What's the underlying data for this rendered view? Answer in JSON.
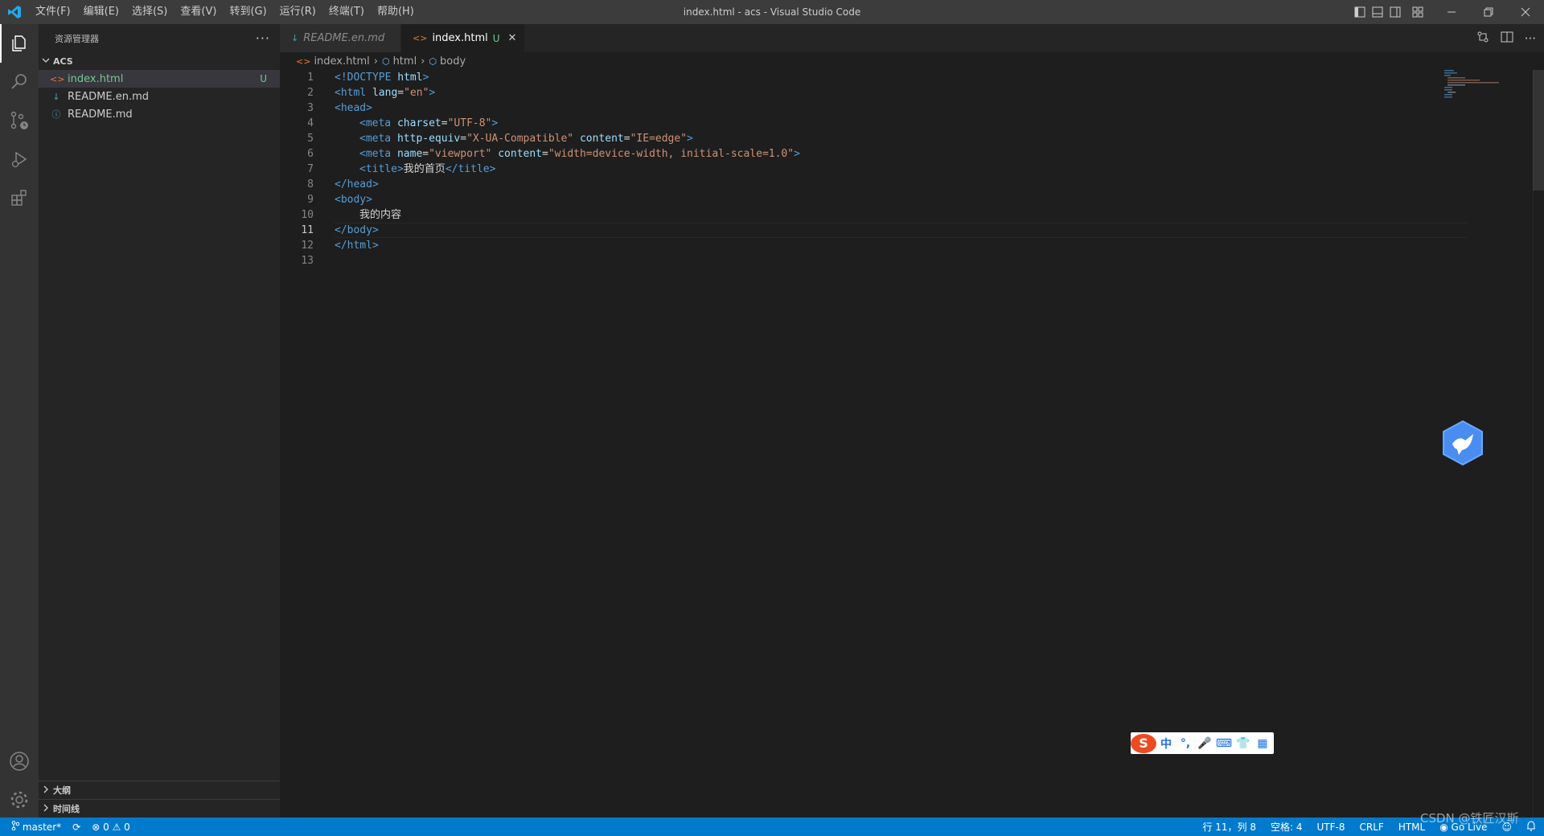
{
  "window": {
    "title": "index.html - acs - Visual Studio Code",
    "menu": [
      "文件(F)",
      "编辑(E)",
      "选择(S)",
      "查看(V)",
      "转到(G)",
      "运行(R)",
      "终端(T)",
      "帮助(H)"
    ]
  },
  "sidebar": {
    "title": "资源管理器",
    "more": "···",
    "folder": "ACS",
    "files": [
      {
        "name": "index.html",
        "icon": "<>",
        "badge": "U"
      },
      {
        "name": "README.en.md",
        "icon": "↓",
        "badge": ""
      },
      {
        "name": "README.md",
        "icon": "ⓘ",
        "badge": ""
      }
    ],
    "bottom_sections": [
      "大纲",
      "时间线"
    ]
  },
  "tabs": [
    {
      "label": "README.en.md",
      "icon": "↓",
      "modified": "",
      "close": ""
    },
    {
      "label": "index.html",
      "icon": "<>",
      "modified": "U",
      "close": "✕"
    }
  ],
  "breadcrumbs": [
    "index.html",
    "html",
    "body"
  ],
  "code": {
    "line_numbers": [
      "1",
      "2",
      "3",
      "4",
      "5",
      "6",
      "7",
      "8",
      "9",
      "10",
      "11",
      "12",
      "13"
    ],
    "current_line": 11,
    "l1a": "<!DOCTYPE ",
    "l1b": "html",
    "l1c": ">",
    "l2a": "<html ",
    "l2b": "lang",
    "l2c": "=",
    "l2d": "\"en\"",
    "l2e": ">",
    "l3": "<head>",
    "l4a": "<meta ",
    "l4b": "charset",
    "l4c": "=",
    "l4d": "\"UTF-8\"",
    "l4e": ">",
    "l5a": "<meta ",
    "l5b": "http-equiv",
    "l5c": "=",
    "l5d": "\"X-UA-Compatible\"",
    "l5e": " ",
    "l5f": "content",
    "l5g": "=",
    "l5h": "\"IE=edge\"",
    "l5i": ">",
    "l6a": "<meta ",
    "l6b": "name",
    "l6c": "=",
    "l6d": "\"viewport\"",
    "l6e": " ",
    "l6f": "content",
    "l6g": "=",
    "l6h": "\"width=device-width, initial-scale=1.0\"",
    "l6i": ">",
    "l7a": "<title>",
    "l7b": "我的首页",
    "l7c": "</title>",
    "l8": "</head>",
    "l9": "<body>",
    "l10": "我的内容",
    "l11": "</body>",
    "l12": "</html>"
  },
  "ime": {
    "logo": "S",
    "items": [
      "中",
      "°,",
      "🎤",
      "⌨",
      "👕",
      "▦"
    ]
  },
  "statusbar": {
    "branch": "master*",
    "sync": "⟳",
    "errors": "0",
    "warnings": "0",
    "position": "行 11，列 8",
    "spaces": "空格: 4",
    "encoding": "UTF-8",
    "eol": "CRLF",
    "language": "HTML",
    "golive": "Go Live"
  },
  "watermark": "CSDN @铁匠汉斯",
  "colors": {
    "accent": "#007acc",
    "untracked": "#73c991",
    "tag": "#569cd6",
    "attr": "#9cdcfe",
    "string": "#ce9178"
  }
}
